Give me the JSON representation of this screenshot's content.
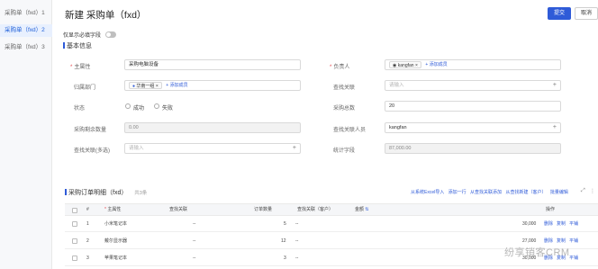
{
  "sidebar": {
    "items": [
      {
        "label": "采购单（fxd）1",
        "close": ""
      },
      {
        "label": "采购单（fxd）2",
        "close": "×"
      },
      {
        "label": "采购单（fxd）3",
        "close": ""
      }
    ]
  },
  "header": {
    "title": "新建 采购单（fxd）",
    "submit_label": "提交",
    "cancel_label": "取消"
  },
  "toggle_label": "仅显示必填字段",
  "basic_section": "基本信息",
  "form": {
    "main_attr_label": "主属性",
    "main_attr_value": "采购电脑设备",
    "owner_label": "负责人",
    "owner_value": "kangfan",
    "owner_add": "+ 添加成员",
    "dept_label": "归属部门",
    "dept_value": "华南一组",
    "dept_add": "+ 添加成员",
    "lookup_label": "查找关联",
    "lookup_placeholder": "请输入",
    "status_label": "状态",
    "status_success": "成功",
    "status_fail": "失败",
    "total_label": "采购总数",
    "total_value": "20",
    "remain_label": "采购剩余数量",
    "remain_value": "0.00",
    "person_label": "查找关联人员",
    "person_value": "kangfan",
    "multi_label": "查找关联(多选)",
    "multi_placeholder": "请输入",
    "stat_label": "统计字段",
    "stat_value": "87,000.00"
  },
  "table_section": {
    "title": "采购订单明细（fxd）",
    "count": "共3条",
    "links": [
      "从系统Excel导入",
      "添加一行",
      "从查找关联添加",
      "从查找新建（客户）",
      "批量编辑"
    ],
    "columns": [
      "#",
      "主属性",
      "查找关联",
      "订单数量",
      "查找关联（客户）",
      "金额",
      "操作"
    ],
    "rows": [
      {
        "no": "1",
        "name": "小米笔记本",
        "lookup": "--",
        "qty": "5",
        "customer": "--",
        "amount": "30,000",
        "ops": [
          "删除",
          "复制",
          "平铺"
        ]
      },
      {
        "no": "2",
        "name": "戴尔显示器",
        "lookup": "--",
        "qty": "12",
        "customer": "--",
        "amount": "27,000",
        "ops": [
          "删除",
          "复制",
          "平铺"
        ]
      },
      {
        "no": "3",
        "name": "苹果笔记本",
        "lookup": "--",
        "qty": "3",
        "customer": "--",
        "amount": "30,000",
        "ops": [
          "删除",
          "复制",
          "平铺"
        ]
      }
    ]
  },
  "watermark": "纷享销客CRM"
}
